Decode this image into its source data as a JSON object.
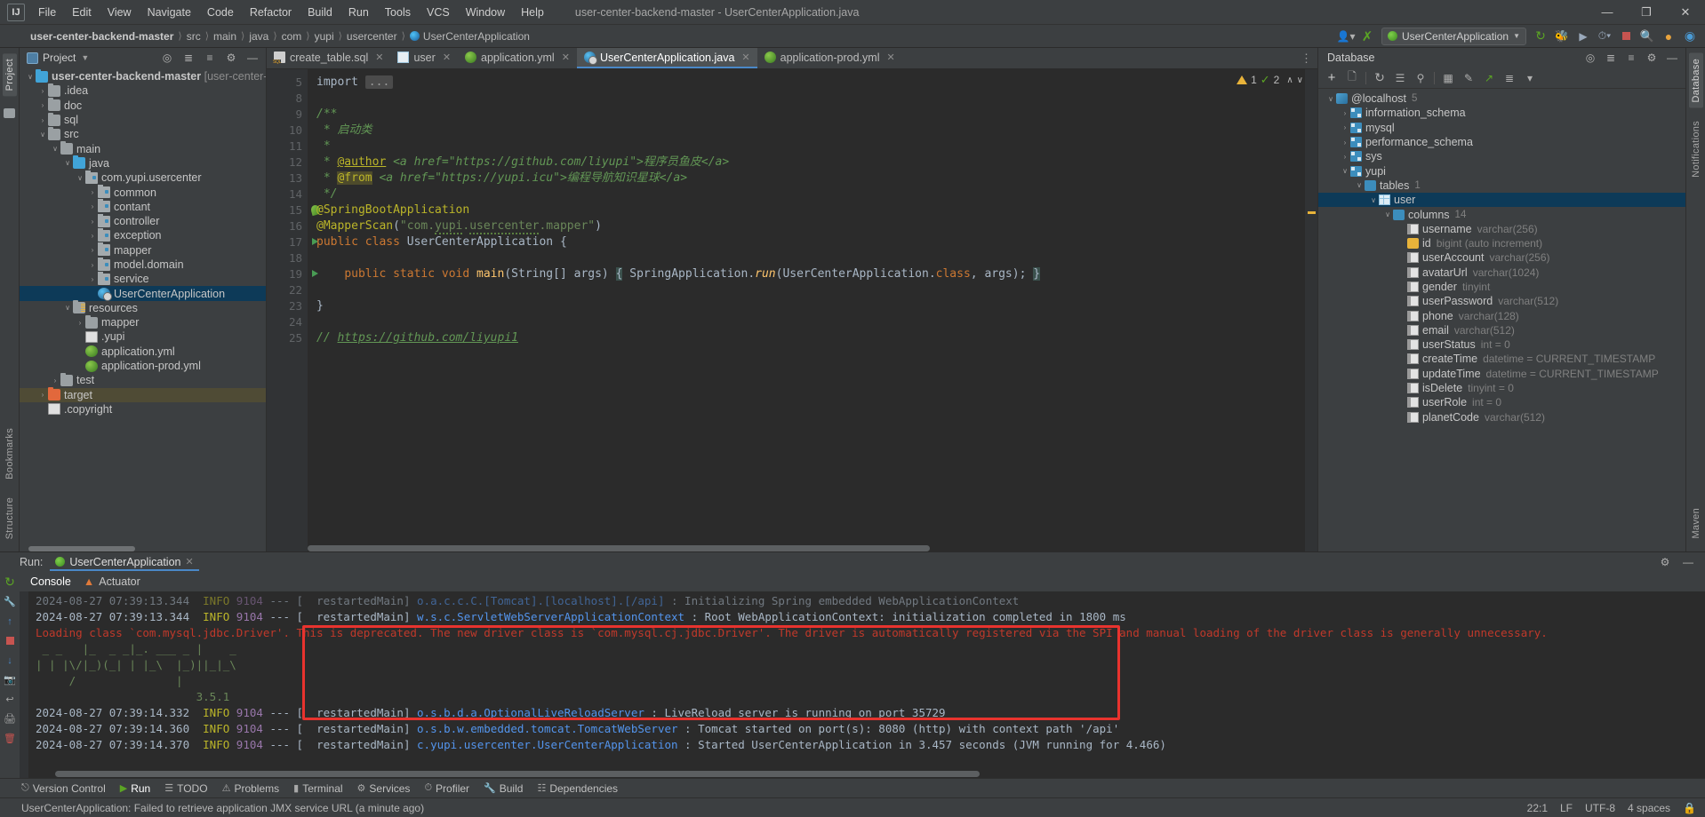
{
  "titlebar": {
    "logo": "IJ",
    "menus": [
      "File",
      "Edit",
      "View",
      "Navigate",
      "Code",
      "Refactor",
      "Build",
      "Run",
      "Tools",
      "VCS",
      "Window",
      "Help"
    ],
    "window_title": "user-center-backend-master - UserCenterApplication.java",
    "minimize": "—",
    "maximize": "❐",
    "close": "✕"
  },
  "navbar": {
    "crumbs": [
      "user-center-backend-master",
      "src",
      "main",
      "java",
      "com",
      "yupi",
      "usercenter",
      "UserCenterApplication"
    ],
    "separator": "〉",
    "run_config": "UserCenterApplication",
    "icons": [
      "profiler-icon",
      "updates-icon",
      "run-icon",
      "debug-icon",
      "coverage-icon",
      "profile-icon",
      "stop-icon",
      "search-icon",
      "notifications-icon",
      "settings-icon"
    ]
  },
  "left_strip": {
    "labels": [
      "Project",
      "Bookmarks",
      "Structure"
    ]
  },
  "project": {
    "title": "Project",
    "tree": [
      {
        "indent": 0,
        "arrow": "∨",
        "icon": "module-folder-icon",
        "label": "user-center-backend-master",
        "suffix": "[user-center-backend]",
        "bold": true,
        "sel": false
      },
      {
        "indent": 1,
        "arrow": "›",
        "icon": "folder-icon",
        "label": ".idea",
        "sel": false
      },
      {
        "indent": 1,
        "arrow": "›",
        "icon": "folder-icon",
        "label": "doc",
        "sel": false
      },
      {
        "indent": 1,
        "arrow": "›",
        "icon": "folder-icon",
        "label": "sql",
        "sel": false
      },
      {
        "indent": 1,
        "arrow": "∨",
        "icon": "folder-icon",
        "label": "src",
        "sel": false
      },
      {
        "indent": 2,
        "arrow": "∨",
        "icon": "folder-icon",
        "label": "main",
        "sel": false
      },
      {
        "indent": 3,
        "arrow": "∨",
        "icon": "source-folder-icon",
        "label": "java",
        "sel": false
      },
      {
        "indent": 4,
        "arrow": "∨",
        "icon": "package-icon",
        "label": "com.yupi.usercenter",
        "sel": false
      },
      {
        "indent": 5,
        "arrow": "›",
        "icon": "package-icon",
        "label": "common",
        "sel": false
      },
      {
        "indent": 5,
        "arrow": "›",
        "icon": "package-icon",
        "label": "contant",
        "sel": false
      },
      {
        "indent": 5,
        "arrow": "›",
        "icon": "package-icon",
        "label": "controller",
        "sel": false
      },
      {
        "indent": 5,
        "arrow": "›",
        "icon": "package-icon",
        "label": "exception",
        "sel": false
      },
      {
        "indent": 5,
        "arrow": "›",
        "icon": "package-icon",
        "label": "mapper",
        "sel": false
      },
      {
        "indent": 5,
        "arrow": "›",
        "icon": "package-icon",
        "label": "model.domain",
        "sel": false
      },
      {
        "indent": 5,
        "arrow": "›",
        "icon": "package-icon",
        "label": "service",
        "sel": false
      },
      {
        "indent": 5,
        "arrow": "",
        "icon": "spring-run-class-icon",
        "label": "UserCenterApplication",
        "sel": true
      },
      {
        "indent": 3,
        "arrow": "∨",
        "icon": "resources-folder-icon",
        "label": "resources",
        "sel": false
      },
      {
        "indent": 4,
        "arrow": "›",
        "icon": "folder-icon",
        "label": "mapper",
        "sel": false
      },
      {
        "indent": 4,
        "arrow": "",
        "icon": "file-icon",
        "label": ".yupi",
        "sel": false
      },
      {
        "indent": 4,
        "arrow": "",
        "icon": "spring-yaml-icon",
        "label": "application.yml",
        "sel": false
      },
      {
        "indent": 4,
        "arrow": "",
        "icon": "spring-yaml-icon",
        "label": "application-prod.yml",
        "sel": false
      },
      {
        "indent": 2,
        "arrow": "›",
        "icon": "folder-icon",
        "label": "test",
        "sel": false
      },
      {
        "indent": 1,
        "arrow": "›",
        "icon": "target-folder-icon",
        "label": "target",
        "sel": false,
        "sel2": true
      },
      {
        "indent": 1,
        "arrow": "",
        "icon": "file-icon",
        "label": ".copyright",
        "sel": false
      }
    ]
  },
  "editor": {
    "tabs": [
      {
        "label": "create_table.sql",
        "icon": "sql-file-icon",
        "active": false
      },
      {
        "label": "user",
        "icon": "table-icon",
        "active": false
      },
      {
        "label": "application.yml",
        "icon": "spring-yaml-icon",
        "active": false
      },
      {
        "label": "UserCenterApplication.java",
        "icon": "spring-class-icon",
        "active": true
      },
      {
        "label": "application-prod.yml",
        "icon": "spring-yaml-icon",
        "active": false
      }
    ],
    "close_glyph": "✕",
    "overflow_glyph": "⋮",
    "inspection": {
      "warnings": "1",
      "checks": "2",
      "up": "∧",
      "down": "∨"
    },
    "line_numbers": [
      "5",
      "8",
      "9",
      "10",
      "11",
      "12",
      "13",
      "14",
      "15",
      "16",
      "17",
      "18",
      "19",
      "22",
      "23",
      "24",
      "25"
    ],
    "lines": [
      {
        "n": "5",
        "html": "import <span class=\"dots\">...</span>",
        "kind": "import"
      },
      {
        "n": "8",
        "html": ""
      },
      {
        "n": "9",
        "html": "<span class=\"c\">/**</span>"
      },
      {
        "n": "10",
        "html": "<span class=\"c\"> * 启动类</span>"
      },
      {
        "n": "11",
        "html": "<span class=\"c\"> *</span>"
      },
      {
        "n": "12",
        "html": "<span class=\"c\"> * </span><span class=\"ann\" style=\"text-decoration:underline\">@author</span><span class=\"c\"> &lt;a href=\"https://github.com/liyupi\"&gt;程序员鱼皮&lt;/a&gt;</span>"
      },
      {
        "n": "13",
        "html": "<span class=\"c\"> * </span><span class=\"ann hl-from\">@from</span><span class=\"c\"> &lt;a href=\"https://yupi.icu\"&gt;编程导航知识星球&lt;/a&gt;</span>"
      },
      {
        "n": "14",
        "html": "<span class=\"c\"> */</span>"
      },
      {
        "n": "15",
        "html": "<span class=\"ann\">@SpringBootApplication</span>"
      },
      {
        "n": "16",
        "html": "<span class=\"ann\">@MapperScan</span><span class=\"p\">(</span><span class=\"s\">\"com.<span class=\"squiggle\">yupi</span>.<span class=\"squiggle\">usercenter</span>.mapper\"</span><span class=\"p\">)</span>"
      },
      {
        "n": "17",
        "html": "<span class=\"k\">public class </span><span class=\"cls\">UserCenterApplication</span> <span class=\"p\">{</span>"
      },
      {
        "n": "18",
        "html": ""
      },
      {
        "n": "19",
        "html": "    <span class=\"k\">public static void </span><span class=\"m\">main</span><span class=\"p\">(</span><span class=\"cls\">String</span><span class=\"p\">[] args)</span> <span class=\"brace-hl\">{</span> <span class=\"cls\">SpringApplication</span>.<span class=\"m\" style=\"font-style:italic\">run</span><span class=\"p\">(</span><span class=\"cls\">UserCenterApplication</span>.<span class=\"k\">class</span><span class=\"p\">, args);</span> <span class=\"brace-hl\">}</span>"
      },
      {
        "n": "22",
        "html": ""
      },
      {
        "n": "23",
        "html": "<span class=\"p\">}</span>"
      },
      {
        "n": "24",
        "html": ""
      },
      {
        "n": "25",
        "html": "<span class=\"c\">// </span><span class=\"c\" style=\"text-decoration:underline\">https://github.com/liyupi1</span>"
      }
    ]
  },
  "database": {
    "title": "Database",
    "toolbar_icons": [
      "add-icon",
      "copy-icon",
      "refresh-icon",
      "query-console-icon",
      "data-source-properties-icon",
      "table-editor-icon",
      "modify-icon",
      "jump-to-icon",
      "expand-icon",
      "collapse-icon",
      "filter-icon"
    ],
    "tree": [
      {
        "indent": 0,
        "arrow": "∨",
        "icon": "datasource-icon",
        "label": "@localhost",
        "count": "5"
      },
      {
        "indent": 1,
        "arrow": "›",
        "icon": "schema-icon",
        "label": "information_schema",
        "count": ""
      },
      {
        "indent": 1,
        "arrow": "›",
        "icon": "schema-icon",
        "label": "mysql",
        "count": ""
      },
      {
        "indent": 1,
        "arrow": "›",
        "icon": "schema-icon",
        "label": "performance_schema",
        "count": ""
      },
      {
        "indent": 1,
        "arrow": "›",
        "icon": "schema-icon",
        "label": "sys",
        "count": ""
      },
      {
        "indent": 1,
        "arrow": "∨",
        "icon": "schema-icon",
        "label": "yupi",
        "count": ""
      },
      {
        "indent": 2,
        "arrow": "∨",
        "icon": "folder-icon",
        "label": "tables",
        "count": "1"
      },
      {
        "indent": 3,
        "arrow": "∨",
        "icon": "table-icon",
        "label": "user",
        "count": "",
        "sel": true
      },
      {
        "indent": 4,
        "arrow": "∨",
        "icon": "folder-icon",
        "label": "columns",
        "count": "14"
      },
      {
        "indent": 5,
        "arrow": "",
        "icon": "column-icon",
        "label": "username",
        "type": "varchar(256)"
      },
      {
        "indent": 5,
        "arrow": "",
        "icon": "primary-key-icon",
        "label": "id",
        "type": "bigint (auto increment)"
      },
      {
        "indent": 5,
        "arrow": "",
        "icon": "column-icon",
        "label": "userAccount",
        "type": "varchar(256)"
      },
      {
        "indent": 5,
        "arrow": "",
        "icon": "column-icon",
        "label": "avatarUrl",
        "type": "varchar(1024)"
      },
      {
        "indent": 5,
        "arrow": "",
        "icon": "column-icon",
        "label": "gender",
        "type": "tinyint"
      },
      {
        "indent": 5,
        "arrow": "",
        "icon": "column-not-null-icon",
        "label": "userPassword",
        "type": "varchar(512)"
      },
      {
        "indent": 5,
        "arrow": "",
        "icon": "column-icon",
        "label": "phone",
        "type": "varchar(128)"
      },
      {
        "indent": 5,
        "arrow": "",
        "icon": "column-icon",
        "label": "email",
        "type": "varchar(512)"
      },
      {
        "indent": 5,
        "arrow": "",
        "icon": "column-not-null-icon",
        "label": "userStatus",
        "type": "int = 0"
      },
      {
        "indent": 5,
        "arrow": "",
        "icon": "column-not-null-icon",
        "label": "createTime",
        "type": "datetime = CURRENT_TIMESTAMP"
      },
      {
        "indent": 5,
        "arrow": "",
        "icon": "column-not-null-icon",
        "label": "updateTime",
        "type": "datetime = CURRENT_TIMESTAMP"
      },
      {
        "indent": 5,
        "arrow": "",
        "icon": "column-not-null-icon",
        "label": "isDelete",
        "type": "tinyint = 0"
      },
      {
        "indent": 5,
        "arrow": "",
        "icon": "column-not-null-icon",
        "label": "userRole",
        "type": "int = 0"
      },
      {
        "indent": 5,
        "arrow": "",
        "icon": "column-icon",
        "label": "planetCode",
        "type": "varchar(512)"
      }
    ]
  },
  "right_strip": {
    "labels": [
      "Database",
      "Notifications",
      "Maven"
    ]
  },
  "run": {
    "label": "Run:",
    "tab": "UserCenterApplication",
    "close_glyph": "✕",
    "settings_glyph": "⚙",
    "minimize_glyph": "—",
    "gutter_icons": [
      "rerun-icon",
      "settings-icon",
      "scroll-up-icon",
      "scroll-down-icon",
      "stop-icon",
      "soft-wrap-icon",
      "camera-icon",
      "print-icon",
      "trash-icon"
    ],
    "console_tabs": [
      {
        "label": "Console",
        "icon": "console-icon",
        "active": true
      },
      {
        "label": "Actuator",
        "icon": "actuator-icon",
        "active": false
      }
    ],
    "console_lines": [
      {
        "type": "log",
        "ts": "2024-08-27 07:39:13.344",
        "level": "INFO",
        "pid": "9104",
        "dash": "---",
        "thread": "[  restartedMain]",
        "logger": "o.a.c.c.C.[Tomcat].[localhost].[/api]",
        "msg": ": Initializing Spring embedded WebApplicationContext",
        "dim": true
      },
      {
        "type": "log",
        "ts": "2024-08-27 07:39:13.344",
        "level": "INFO",
        "pid": "9104",
        "dash": "---",
        "thread": "[  restartedMain]",
        "logger": "w.s.c.ServletWebServerApplicationContext",
        "msg": ": Root WebApplicationContext: initialization completed in 1800 ms"
      },
      {
        "type": "warn",
        "text": "Loading class `com.mysql.jdbc.Driver'. This is deprecated. The new driver class is `com.mysql.cj.jdbc.Driver'. The driver is automatically registered via the SPI and manual loading of the driver class is generally unnecessary."
      },
      {
        "type": "ascii",
        "text": " _ _   |_  _ _|_. ___ _ |    _ "
      },
      {
        "type": "ascii",
        "text": "| | |\\/|_)(_| | |_\\  |_)||_|_\\ "
      },
      {
        "type": "ascii",
        "text": "     /               |         "
      },
      {
        "type": "ascii",
        "text": "                        3.5.1 "
      },
      {
        "type": "log",
        "ts": "2024-08-27 07:39:14.332",
        "level": "INFO",
        "pid": "9104",
        "dash": "---",
        "thread": "[  restartedMain]",
        "logger": "o.s.b.d.a.OptionalLiveReloadServer",
        "msg": ": LiveReload server is running on port 35729"
      },
      {
        "type": "log",
        "ts": "2024-08-27 07:39:14.360",
        "level": "INFO",
        "pid": "9104",
        "dash": "---",
        "thread": "[  restartedMain]",
        "logger": "o.s.b.w.embedded.tomcat.TomcatWebServer",
        "msg": ": Tomcat started on port(s): 8080 (http) with context path '/api'"
      },
      {
        "type": "log",
        "ts": "2024-08-27 07:39:14.370",
        "level": "INFO",
        "pid": "9104",
        "dash": "---",
        "thread": "[  restartedMain]",
        "logger": "c.yupi.usercenter.UserCenterApplication",
        "msg": ": Started UserCenterApplication in 3.457 seconds (JVM running for 4.466)"
      }
    ],
    "highlight_color": "#e8332e"
  },
  "toolwindow_bar": {
    "items": [
      {
        "label": "Version Control",
        "icon": "vcs-icon",
        "active": false
      },
      {
        "label": "Run",
        "icon": "run-icon",
        "active": true
      },
      {
        "label": "TODO",
        "icon": "todo-icon",
        "active": false
      },
      {
        "label": "Problems",
        "icon": "problems-icon",
        "active": false
      },
      {
        "label": "Terminal",
        "icon": "terminal-icon",
        "active": false
      },
      {
        "label": "Services",
        "icon": "services-icon",
        "active": false
      },
      {
        "label": "Profiler",
        "icon": "profiler-icon",
        "active": false
      },
      {
        "label": "Build",
        "icon": "build-icon",
        "active": false
      },
      {
        "label": "Dependencies",
        "icon": "dependencies-icon",
        "active": false
      }
    ]
  },
  "statusbar": {
    "message": "UserCenterApplication: Failed to retrieve application JMX service URL (a minute ago)",
    "caret": "22:1",
    "line_sep": "LF",
    "encoding": "UTF-8",
    "indent": "4 spaces",
    "lock": "🔒"
  }
}
